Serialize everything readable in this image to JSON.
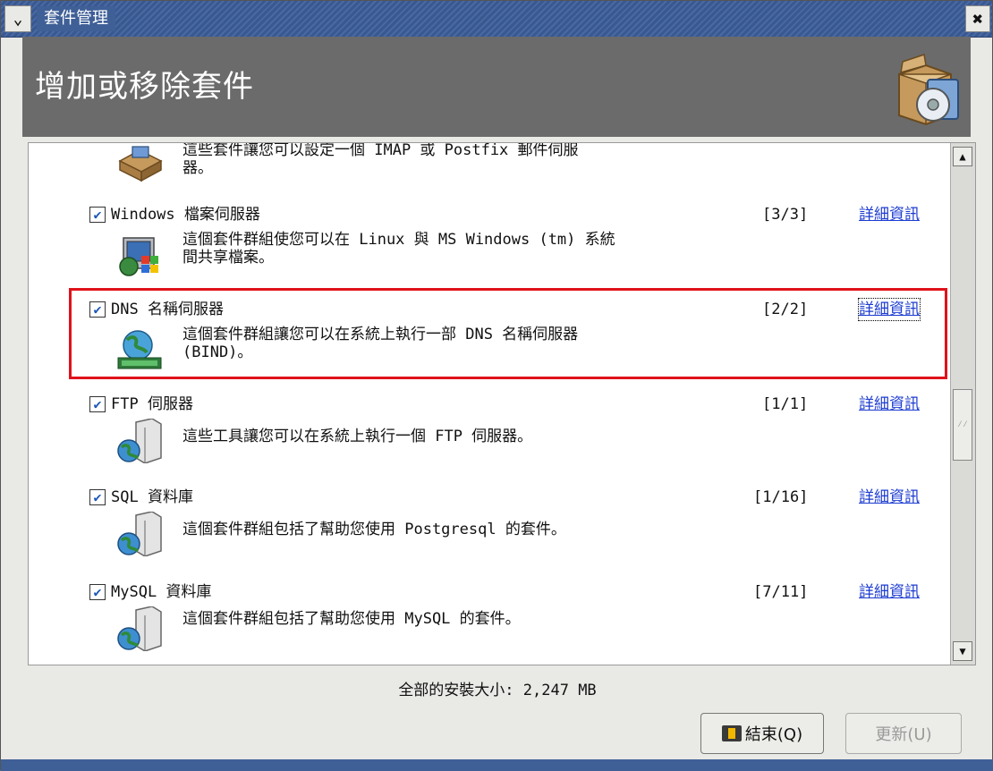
{
  "window": {
    "title": "套件管理"
  },
  "header": {
    "title": "增加或移除套件"
  },
  "packages": [
    {
      "name": "",
      "count": "",
      "link": "",
      "desc": [
        "這些套件讓您可以設定一個 IMAP 或 Postfix 郵件伺服",
        "器。"
      ]
    },
    {
      "name": "Windows 檔案伺服器",
      "count": "[3/3]",
      "link": "詳細資訊",
      "desc": [
        "這個套件群組使您可以在 Linux 與 MS Windows (tm) 系統",
        "間共享檔案。"
      ]
    },
    {
      "name": "DNS 名稱伺服器",
      "count": "[2/2]",
      "link": "詳細資訊",
      "desc": [
        "這個套件群組讓您可以在系統上執行一部 DNS 名稱伺服器",
        "(BIND)。"
      ]
    },
    {
      "name": "FTP 伺服器",
      "count": "[1/1]",
      "link": "詳細資訊",
      "desc": [
        "這些工具讓您可以在系統上執行一個 FTP 伺服器。"
      ]
    },
    {
      "name": "SQL 資料庫",
      "count": "[1/16]",
      "link": "詳細資訊",
      "desc": [
        "這個套件群組包括了幫助您使用 Postgresql 的套件。"
      ]
    },
    {
      "name": "MySQL 資料庫",
      "count": "[7/11]",
      "link": "詳細資訊",
      "desc": [
        "這個套件群組包括了幫助您使用 MySQL 的套件。"
      ]
    }
  ],
  "footer": {
    "total": "全部的安裝大小: 2,247 MB",
    "quit_label": "結束(Q)",
    "update_label": "更新(U)"
  },
  "colors": {
    "titlebar": "#3f5f97",
    "header": "#6b6b6b",
    "link": "#1c3bd0",
    "highlight": "#e0121b",
    "check": "#1d57b8"
  },
  "icons": {
    "menu": "chevron-down-icon",
    "close": "close-icon",
    "box": "package-box-icon",
    "mail": "mail-server-icon",
    "windows": "windows-server-icon",
    "globe": "globe-server-icon",
    "server": "server-icon",
    "quit": "exit-icon"
  }
}
